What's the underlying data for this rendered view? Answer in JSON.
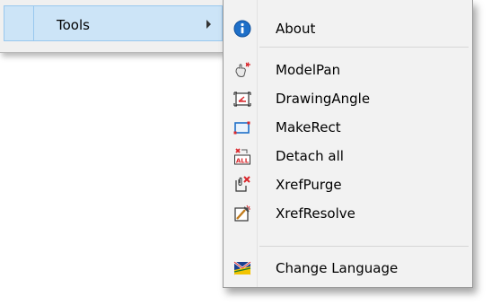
{
  "parent_menu": {
    "item_label": "Tools"
  },
  "submenu": {
    "items": [
      {
        "label": "About",
        "icon": "info-icon"
      },
      {
        "label": "ModelPan",
        "icon": "pan-hand-icon"
      },
      {
        "label": "DrawingAngle",
        "icon": "drawing-angle-icon"
      },
      {
        "label": "MakeRect",
        "icon": "rectangle-icon"
      },
      {
        "label": "Detach all",
        "icon": "detach-all-icon"
      },
      {
        "label": "XrefPurge",
        "icon": "xref-purge-icon"
      },
      {
        "label": "XrefResolve",
        "icon": "xref-resolve-icon"
      },
      {
        "label": "Change Language",
        "icon": "flag-icon"
      }
    ],
    "icon_text": {
      "detach_all": "ALL"
    }
  },
  "colors": {
    "highlight": "#cce4f7",
    "highlight_border": "#99c8ee",
    "menu_bg": "#f2f2f2",
    "info_blue": "#1e6fc8",
    "accent_red": "#d9262b"
  }
}
